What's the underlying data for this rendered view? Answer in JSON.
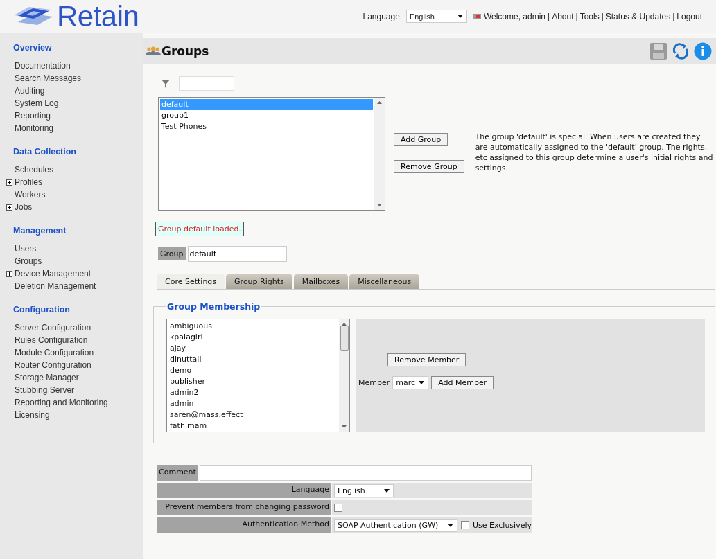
{
  "header": {
    "logo_text": "Retain",
    "language_label": "Language",
    "language_value": "English",
    "links": [
      "Welcome, admin",
      "About",
      "Tools",
      "Status & Updates",
      "Logout"
    ],
    "separator": "|"
  },
  "sidebar": [
    {
      "heading": "Overview",
      "items": [
        {
          "label": "Documentation",
          "expandable": false
        },
        {
          "label": "Search Messages",
          "expandable": false
        },
        {
          "label": "Auditing",
          "expandable": false
        },
        {
          "label": "System Log",
          "expandable": false
        },
        {
          "label": "Reporting",
          "expandable": false
        },
        {
          "label": "Monitoring",
          "expandable": false
        }
      ]
    },
    {
      "heading": "Data Collection",
      "items": [
        {
          "label": "Schedules",
          "expandable": false
        },
        {
          "label": "Profiles",
          "expandable": true
        },
        {
          "label": "Workers",
          "expandable": false
        },
        {
          "label": "Jobs",
          "expandable": true
        }
      ]
    },
    {
      "heading": "Management",
      "items": [
        {
          "label": "Users",
          "expandable": false
        },
        {
          "label": "Groups",
          "expandable": false
        },
        {
          "label": "Device Management",
          "expandable": true
        },
        {
          "label": "Deletion Management",
          "expandable": false
        }
      ]
    },
    {
      "heading": "Configuration",
      "items": [
        {
          "label": "Server Configuration",
          "expandable": false
        },
        {
          "label": "Rules Configuration",
          "expandable": false
        },
        {
          "label": "Module Configuration",
          "expandable": false
        },
        {
          "label": "Router Configuration",
          "expandable": false
        },
        {
          "label": "Storage Manager",
          "expandable": false
        },
        {
          "label": "Stubbing Server",
          "expandable": false
        },
        {
          "label": "Reporting and Monitoring",
          "expandable": false
        },
        {
          "label": "Licensing",
          "expandable": false
        }
      ]
    }
  ],
  "page": {
    "title": "Groups"
  },
  "groups": [
    {
      "label": "default",
      "selected": true
    },
    {
      "label": "group1",
      "selected": false
    },
    {
      "label": "Test Phones",
      "selected": false
    }
  ],
  "group_buttons": [
    "Add Group",
    "Remove Group"
  ],
  "description": "The group 'default' is special. When users are created they are automatically assigned to the 'default' group. The rights, etc assigned to this group determine a user's initial rights and settings.",
  "status_message": "Group default loaded.",
  "group_field": {
    "label": "Group",
    "value": "default"
  },
  "tabs": [
    {
      "label": "Core Settings",
      "selected": true
    },
    {
      "label": "Group Rights",
      "selected": false
    },
    {
      "label": "Mailboxes",
      "selected": false
    },
    {
      "label": "Miscellaneous",
      "selected": false
    }
  ],
  "membership": {
    "title": "Group Membership",
    "members": [
      "ambiguous",
      "kpalagiri",
      "ajay",
      "dlnuttall",
      "demo",
      "publisher",
      "admin2",
      "admin",
      "saren@mass.effect",
      "fathimam"
    ],
    "remove_button": "Remove Member",
    "member_label": "Member",
    "member_value": "marc",
    "add_button": "Add Member"
  },
  "comment": {
    "label": "Comment"
  },
  "settings": [
    {
      "kind": "select",
      "label": "Language",
      "value": "English"
    },
    {
      "kind": "checkbox",
      "label": "Prevent members from changing password",
      "checked": false
    },
    {
      "kind": "select_option",
      "label": "Authentication Method",
      "value": "SOAP Authentication (GW)",
      "option": {
        "label": "Use Exclusively",
        "checked": false
      }
    }
  ]
}
